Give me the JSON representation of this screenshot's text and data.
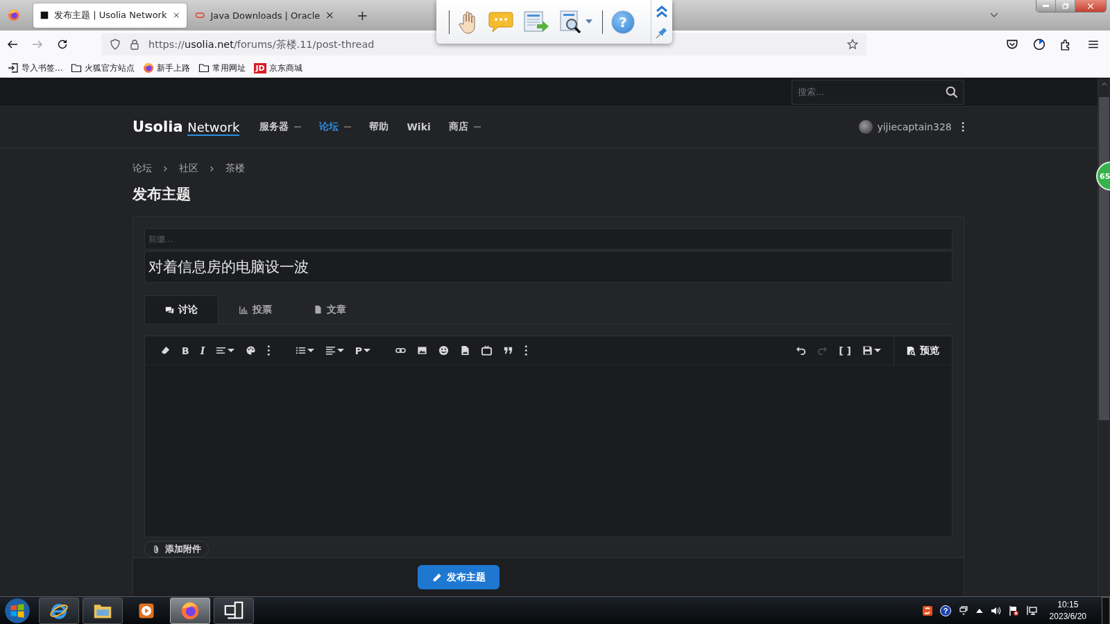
{
  "browser": {
    "tabs": [
      {
        "title": "发布主题 | Usolia Network",
        "selected": true
      },
      {
        "title": "Java Downloads | Oracle",
        "selected": false
      }
    ],
    "new_tab": "+",
    "url": {
      "scheme": "https://",
      "host": "usolia.net",
      "path": "/forums/茶楼.11/post-thread"
    },
    "bookmarks": [
      {
        "label": "导入书签...",
        "kind": "import"
      },
      {
        "label": "火狐官方站点",
        "kind": "folder"
      },
      {
        "label": "新手上路",
        "kind": "firefox"
      },
      {
        "label": "常用网址",
        "kind": "folder"
      },
      {
        "label": "京东商城",
        "kind": "shop",
        "logo_text": "JD"
      }
    ]
  },
  "floating_toolbar": {
    "help_glyph": "?"
  },
  "site": {
    "search_placeholder": "搜索...",
    "logo": {
      "brand": "Usolia",
      "suffix": "Network"
    },
    "nav": [
      {
        "label": "服务器",
        "caret": true,
        "selected": false
      },
      {
        "label": "论坛",
        "caret": true,
        "selected": true
      },
      {
        "label": "帮助",
        "caret": false,
        "selected": false
      },
      {
        "label": "Wiki",
        "caret": false,
        "selected": false
      },
      {
        "label": "商店",
        "caret": true,
        "selected": false
      }
    ],
    "user": "yijiecaptain328",
    "side_badge": "65"
  },
  "breadcrumbs": [
    "论坛",
    "社区",
    "茶楼"
  ],
  "page_title": "发布主题",
  "form": {
    "prefix_placeholder": "前缀...",
    "title_value": "对着信息房的电脑设一波",
    "tabs": [
      {
        "label": "讨论",
        "kind": "discussion",
        "selected": true
      },
      {
        "label": "投票",
        "kind": "poll",
        "selected": false
      },
      {
        "label": "文章",
        "kind": "article",
        "selected": false
      }
    ],
    "toolbar": [
      {
        "items": [
          {
            "kind": "eraser",
            "caret": false,
            "disabled": false
          },
          {
            "kind": "bold",
            "label": "B",
            "caret": false,
            "disabled": false
          },
          {
            "kind": "italic",
            "label": "I",
            "caret": false,
            "disabled": false
          },
          {
            "kind": "lines",
            "caret": true,
            "disabled": false
          },
          {
            "kind": "palette",
            "caret": false,
            "disabled": false
          },
          {
            "kind": "more",
            "caret": false,
            "disabled": false
          }
        ]
      },
      {
        "items": [
          {
            "kind": "bullets",
            "caret": true,
            "disabled": false
          },
          {
            "kind": "align",
            "caret": true,
            "disabled": false
          },
          {
            "kind": "paragraph",
            "label": "P",
            "caret": true,
            "disabled": false
          }
        ]
      },
      {
        "items": [
          {
            "kind": "link",
            "caret": false,
            "disabled": false
          },
          {
            "kind": "image",
            "caret": false,
            "disabled": false
          },
          {
            "kind": "smiley",
            "caret": false,
            "disabled": false
          },
          {
            "kind": "imagefile",
            "caret": false,
            "disabled": false
          },
          {
            "kind": "tv",
            "caret": false,
            "disabled": false
          },
          {
            "kind": "quote",
            "caret": false,
            "disabled": false
          },
          {
            "kind": "more",
            "caret": false,
            "disabled": false
          }
        ]
      }
    ],
    "toolbar_right": [
      {
        "kind": "undo",
        "caret": false,
        "disabled": false
      },
      {
        "kind": "redo",
        "caret": false,
        "disabled": true
      },
      {
        "kind": "source",
        "label": "[ ]",
        "caret": false,
        "disabled": false
      },
      {
        "kind": "save",
        "caret": true,
        "disabled": false
      }
    ],
    "preview": "预览",
    "attach": "添加附件",
    "submit": "发布主题"
  },
  "taskbar": {
    "apps": [
      {
        "kind": "browser",
        "selected": false
      },
      {
        "kind": "files",
        "selected": false
      },
      {
        "kind": "media",
        "selected": false
      },
      {
        "kind": "firefox",
        "selected": true
      },
      {
        "kind": "remote",
        "selected": false
      }
    ],
    "tray": [
      {
        "kind": "ime"
      },
      {
        "kind": "help",
        "glyph": "?"
      },
      {
        "kind": "switch"
      },
      {
        "kind": "overflow"
      },
      {
        "kind": "volume"
      },
      {
        "kind": "flag"
      },
      {
        "kind": "network"
      }
    ],
    "time": "10:15",
    "date": "2023/6/20"
  }
}
